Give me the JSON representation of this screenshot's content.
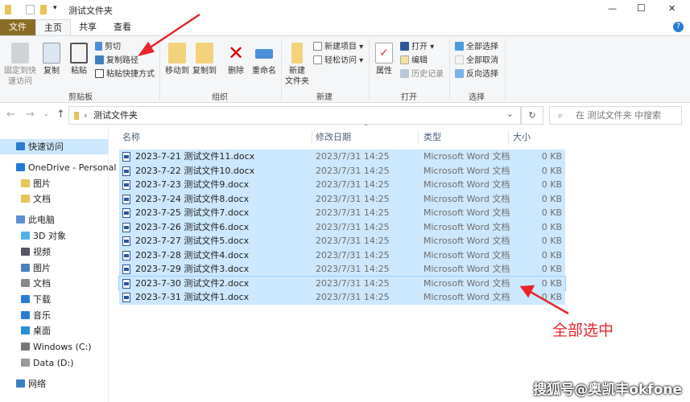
{
  "window": {
    "title": "测试文件夹",
    "minimize": "—",
    "maximize": "☐",
    "close": "✕",
    "help": "?"
  },
  "tabs": [
    "文件",
    "主页",
    "共享",
    "查看"
  ],
  "ribbon": {
    "clipboard": {
      "label": "剪贴板",
      "pin": "固定到快速访问",
      "copy": "复制",
      "paste": "粘贴",
      "cut": "剪切",
      "copy_path": "复制路径",
      "paste_shortcut": "粘贴快捷方式"
    },
    "organize": {
      "label": "组织",
      "move_to": "移动到",
      "copy_to": "复制到",
      "delete": "删除",
      "rename": "重命名"
    },
    "new": {
      "label": "新建",
      "new_folder": "新建\n文件夹",
      "new_item": "新建项目 ▾",
      "easy_access": "轻松访问 ▾"
    },
    "open": {
      "label": "打开",
      "properties": "属性",
      "open": "打开 ▾",
      "edit": "编辑",
      "history": "历史记录"
    },
    "select": {
      "label": "选择",
      "select_all": "全部选择",
      "select_none": "全部取消",
      "invert": "反向选择"
    }
  },
  "address": {
    "back": "←",
    "forward": "→",
    "up": "↑",
    "path": "测试文件夹",
    "dropdown": "⌄",
    "refresh": "↻",
    "search_placeholder": "在 测试文件夹 中搜索"
  },
  "sidebar": [
    {
      "label": "快速访问",
      "color": "#2b7cd3"
    },
    {
      "label": "OneDrive - Personal",
      "color": "#1e7ad6"
    },
    {
      "label": "图片",
      "color": "#e8c25b"
    },
    {
      "label": "文档",
      "color": "#e8c25b"
    },
    {
      "label": "此电脑",
      "color": "#5b8fd0"
    },
    {
      "label": "3D 对象",
      "color": "#4fb3e8"
    },
    {
      "label": "视频",
      "color": "#556"
    },
    {
      "label": "图片",
      "color": "#4a7fc0"
    },
    {
      "label": "文档",
      "color": "#888"
    },
    {
      "label": "下载",
      "color": "#2b7cd3"
    },
    {
      "label": "音乐",
      "color": "#2b7cd3"
    },
    {
      "label": "桌面",
      "color": "#2b8fd3"
    },
    {
      "label": "Windows (C:)",
      "color": "#777"
    },
    {
      "label": "Data (D:)",
      "color": "#999"
    },
    {
      "label": "网络",
      "color": "#3a7fc0"
    }
  ],
  "columns": [
    "名称",
    "修改日期",
    "类型",
    "大小"
  ],
  "files": [
    {
      "name": "2023-7-21 测试文件11.docx",
      "date": "2023/7/31 14:25",
      "type": "Microsoft Word 文档",
      "size": "0 KB"
    },
    {
      "name": "2023-7-22 测试文件10.docx",
      "date": "2023/7/31 14:25",
      "type": "Microsoft Word 文档",
      "size": "0 KB"
    },
    {
      "name": "2023-7-23 测试文件9.docx",
      "date": "2023/7/31 14:25",
      "type": "Microsoft Word 文档",
      "size": "0 KB"
    },
    {
      "name": "2023-7-24 测试文件8.docx",
      "date": "2023/7/31 14:25",
      "type": "Microsoft Word 文档",
      "size": "0 KB"
    },
    {
      "name": "2023-7-25 测试文件7.docx",
      "date": "2023/7/31 14:25",
      "type": "Microsoft Word 文档",
      "size": "0 KB"
    },
    {
      "name": "2023-7-26 测试文件6.docx",
      "date": "2023/7/31 14:25",
      "type": "Microsoft Word 文档",
      "size": "0 KB"
    },
    {
      "name": "2023-7-27 测试文件5.docx",
      "date": "2023/7/31 14:25",
      "type": "Microsoft Word 文档",
      "size": "0 KB"
    },
    {
      "name": "2023-7-28 测试文件4.docx",
      "date": "2023/7/31 14:25",
      "type": "Microsoft Word 文档",
      "size": "0 KB"
    },
    {
      "name": "2023-7-29 测试文件3.docx",
      "date": "2023/7/31 14:25",
      "type": "Microsoft Word 文档",
      "size": "0 KB"
    },
    {
      "name": "2023-7-30 测试文件2.docx",
      "date": "2023/7/31 14:25",
      "type": "Microsoft Word 文档",
      "size": "0 KB"
    },
    {
      "name": "2023-7-31 测试文件1.docx",
      "date": "2023/7/31 14:25",
      "type": "Microsoft Word 文档",
      "size": "0 KB"
    }
  ],
  "annotation": "全部选中",
  "watermark": "搜狐号@奥凯丰okfone"
}
